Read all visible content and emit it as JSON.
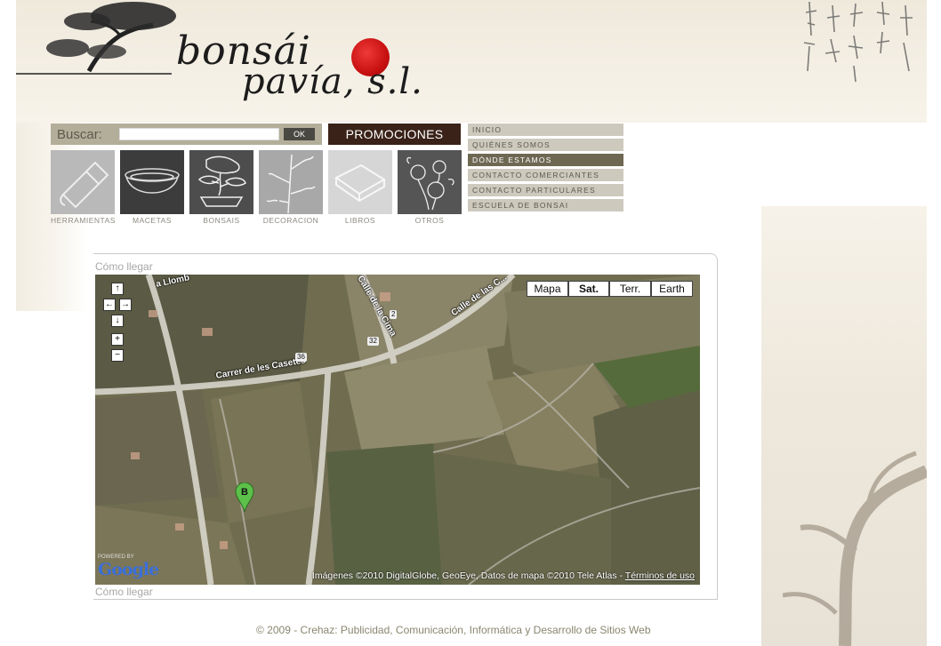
{
  "header": {
    "logo_line1": "bonsái",
    "logo_line2": "pavía, s.l."
  },
  "search": {
    "label": "Buscar:",
    "placeholder": "",
    "button": "OK"
  },
  "promo_label": "PROMOCIONES",
  "categories": [
    {
      "label": "HERRAMIENTAS",
      "icon": "tube-icon"
    },
    {
      "label": "MACETAS",
      "icon": "pot-icon"
    },
    {
      "label": "BONSAIS",
      "icon": "bonsai-icon"
    },
    {
      "label": "DECORACION",
      "icon": "bamboo-icon"
    },
    {
      "label": "LIBROS",
      "icon": "book-icon"
    },
    {
      "label": "OTROS",
      "icon": "flower-icon"
    }
  ],
  "nav": {
    "items": [
      {
        "label": "INICIO",
        "active": false
      },
      {
        "label": "QUIÉNES SOMOS",
        "active": false
      },
      {
        "label": "DÓNDE ESTAMOS",
        "active": true
      },
      {
        "label": "CONTACTO COMERCIANTES",
        "active": false
      },
      {
        "label": "CONTACTO PARTICULARES",
        "active": false
      },
      {
        "label": "ESCUELA DE BONSAI",
        "active": false
      }
    ]
  },
  "map": {
    "caption_top": "Cómo llegar",
    "caption_bottom": "Cómo llegar",
    "types": [
      "Mapa",
      "Sat.",
      "Terr.",
      "Earth"
    ],
    "selected_type": "Sat.",
    "streets": [
      "Carrer de les Casetes",
      "Calle de la Cima",
      "Calle de las C...",
      "a Llomb"
    ],
    "road_numbers": [
      "36",
      "32",
      "2"
    ],
    "marker_label": "B",
    "attribution": "Imágenes ©2010 DigitalGlobe, GeoEye, Datos de mapa ©2010 Tele Atlas -",
    "terms": "Términos de uso",
    "logo": "Google",
    "logo_small": "POWERED BY"
  },
  "footer": "© 2009 - Crehaz: Publicidad, Comunicación, Informática y Desarrollo de Sitios Web",
  "colors": {
    "promo_bg": "#3a2218",
    "nav_bg": "#cdc9bd",
    "nav_active_bg": "#6e6752",
    "logo_red": "#c81010",
    "search_bg": "#b3ae99"
  }
}
